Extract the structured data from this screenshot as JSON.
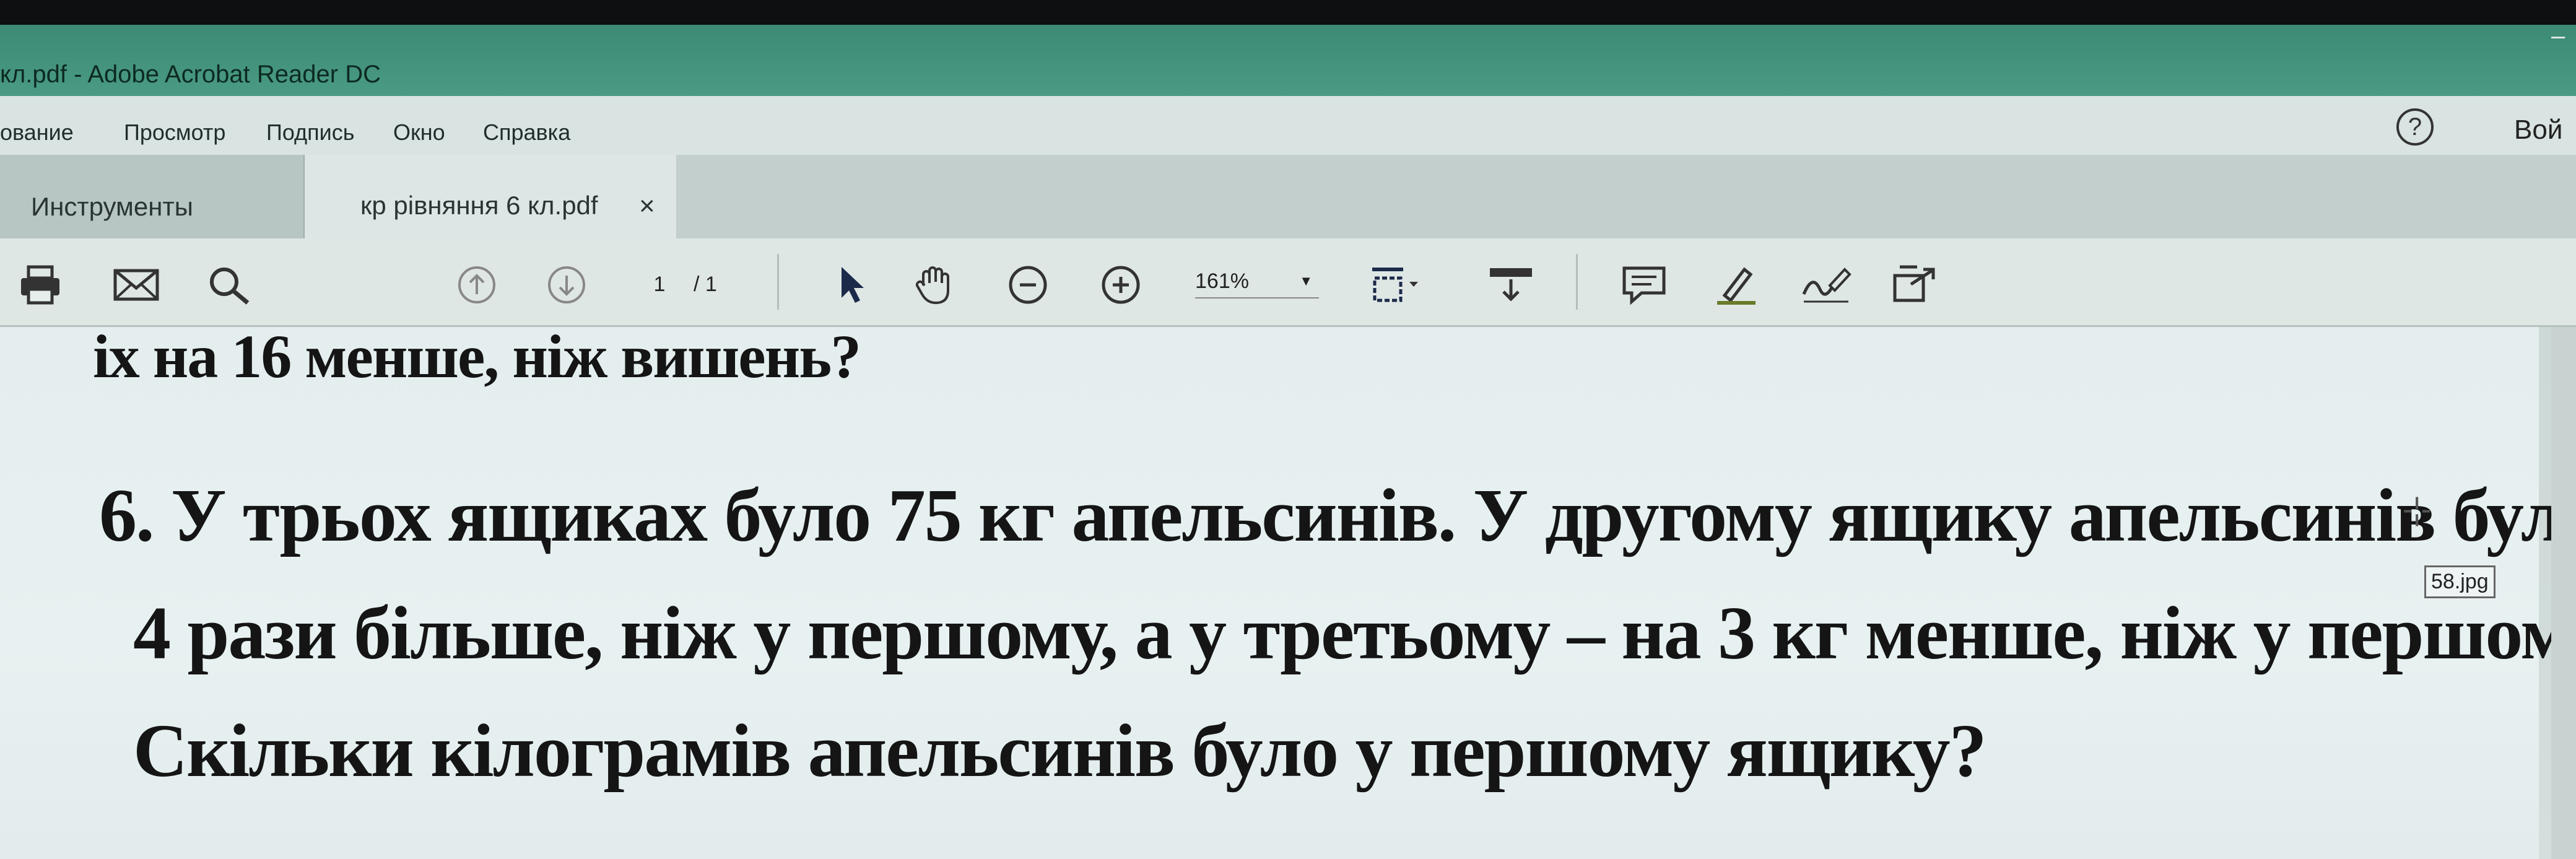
{
  "window": {
    "title": "кл.pdf - Adobe Acrobat Reader DC"
  },
  "menu": {
    "items": [
      "ование",
      "Просмотр",
      "Подпись",
      "Окно",
      "Справка"
    ],
    "help_label": "?",
    "login_label": "Вой"
  },
  "tabs": {
    "tools_label": "Инструменты",
    "doc_label": "кр рівняння 6 кл.pdf",
    "close_label": "×"
  },
  "toolbar": {
    "page_current": "1",
    "page_total": "/ 1",
    "zoom": "161%",
    "icons": [
      "print-icon",
      "email-icon",
      "search-icon",
      "prev-page-icon",
      "next-page-icon",
      "select-cursor-icon",
      "hand-icon",
      "zoom-out-icon",
      "zoom-in-icon",
      "fit-page-icon",
      "scroll-mode-icon",
      "comment-icon",
      "highlight-pen-icon",
      "sign-icon",
      "share-icon"
    ]
  },
  "document": {
    "cut_line": "іх на 16 менше, ніж вишень?",
    "line1": "6.  У трьох ящиках було 75 кг апельсинів. У другому ящику апельсинів було в",
    "line2": "4 рази більше, ніж у першому, а у третьому – на 3 кг менше, ніж у першому.",
    "line3": "Скільки кілограмів апельсинів було у першому ящику?"
  },
  "overlay": {
    "file_tag": "58.jpg"
  }
}
